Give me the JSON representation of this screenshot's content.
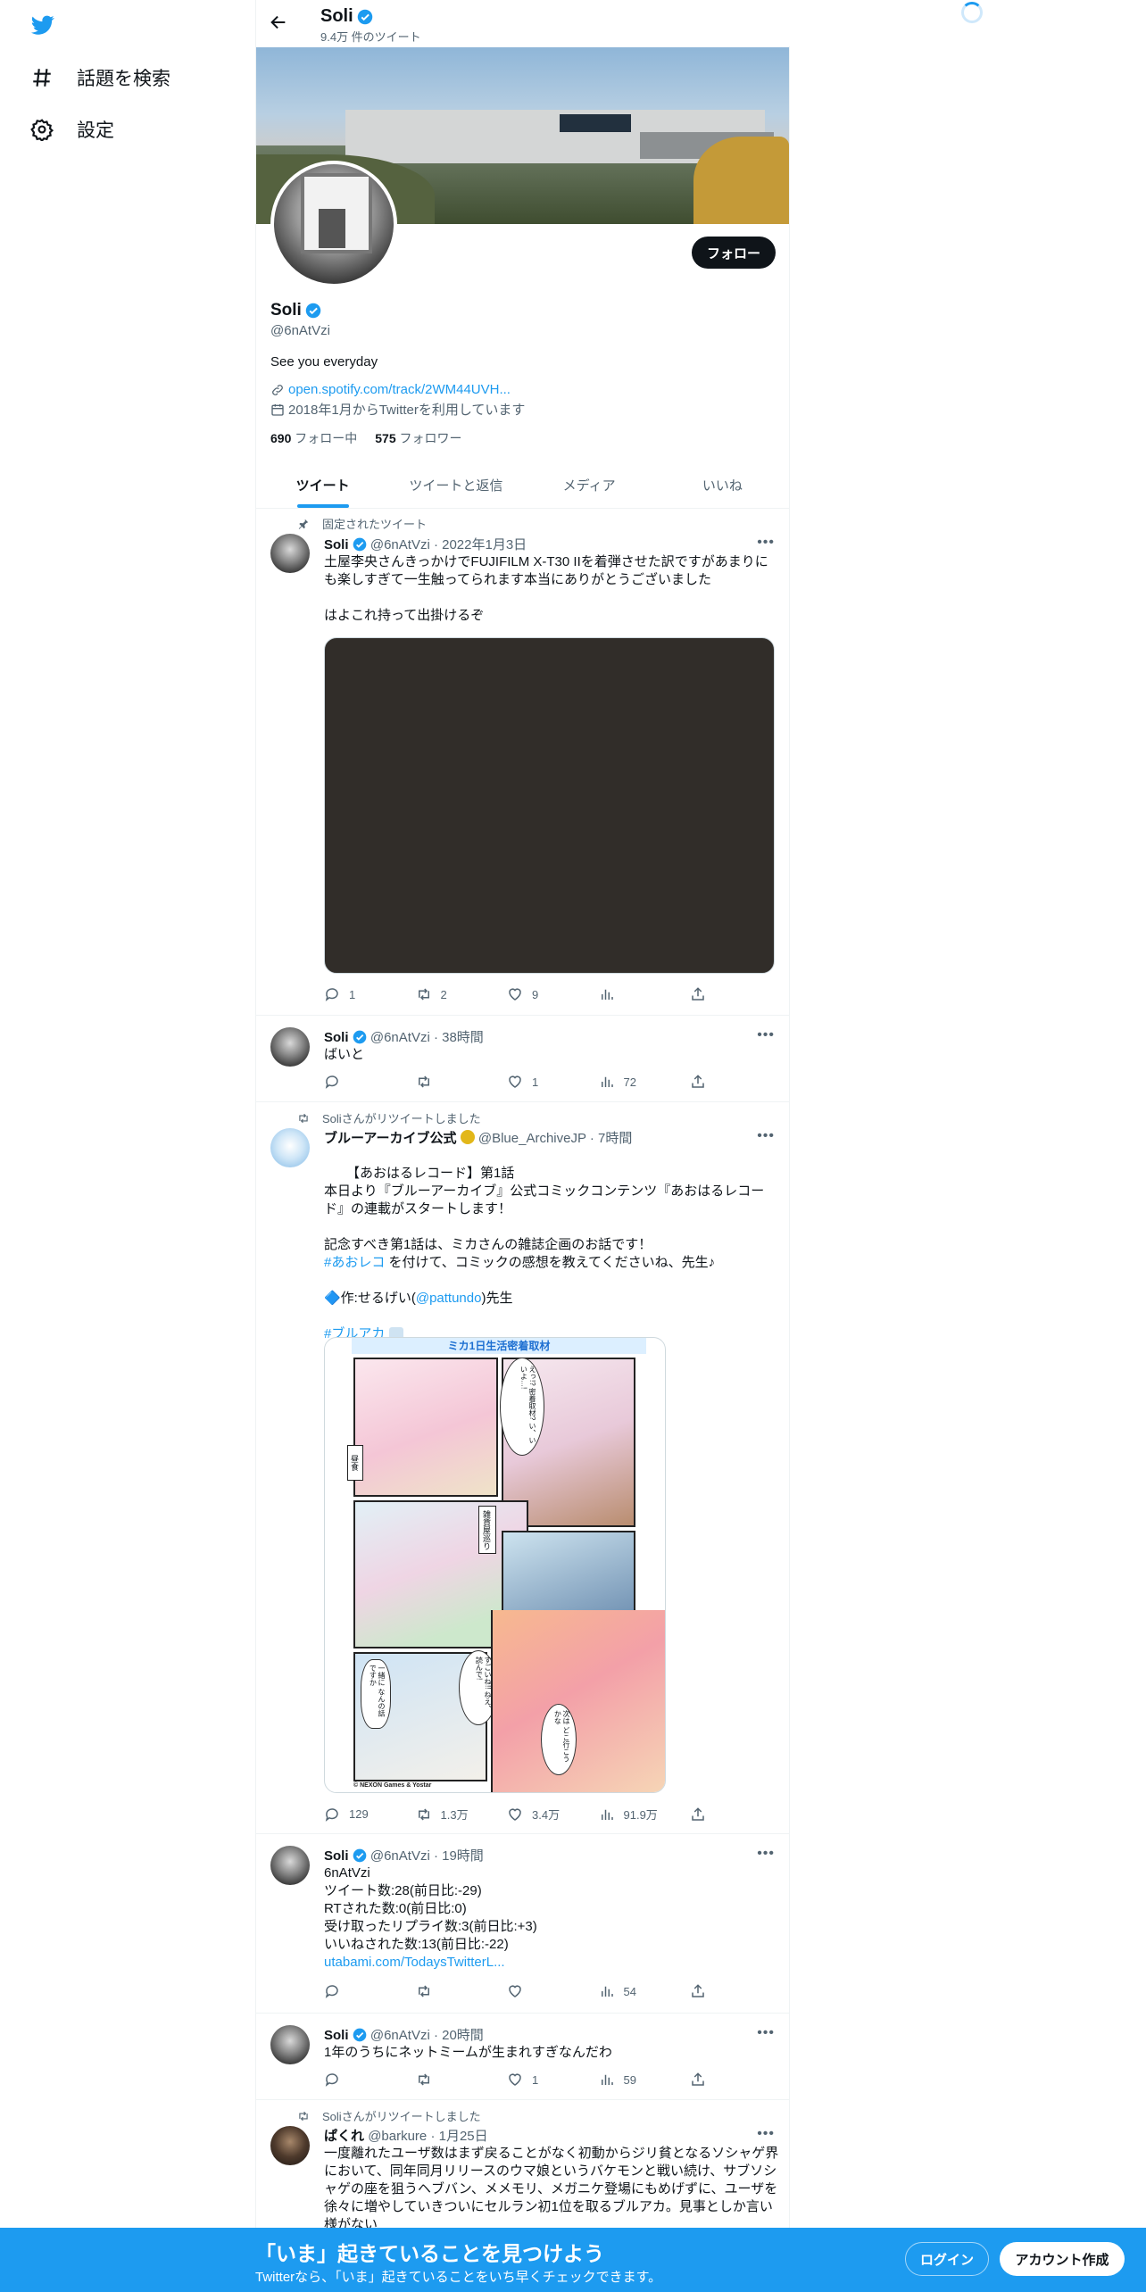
{
  "sidebar": {
    "explore_label": "話題を検索",
    "settings_label": "設定"
  },
  "header": {
    "name": "Soli",
    "tweet_count": "9.4万 件のツイート"
  },
  "profile": {
    "name": "Soli",
    "handle": "@6nAtVzi",
    "bio": "See you everyday",
    "link": "open.spotify.com/track/2WM44UVH...",
    "joined": "2018年1月からTwitterを利用しています",
    "following_count": "690",
    "following_label": "フォロー中",
    "followers_count": "575",
    "followers_label": "フォロワー",
    "follow_button": "フォロー"
  },
  "tabs": [
    "ツイート",
    "ツイートと返信",
    "メディア",
    "いいね"
  ],
  "tweets": [
    {
      "context": "固定されたツイート",
      "name": "Soli",
      "handle": "@6nAtVzi",
      "time": "2022年1月3日",
      "text": "土屋李央さんきっかけでFUJIFILM X-T30 IIを着弾させた訳ですがあまりにも楽しすぎて一生触ってられます本当にありがとうございました\n\nはよこれ持って出掛けるぞ",
      "reply": "1",
      "retweet": "2",
      "like": "9",
      "views": ""
    },
    {
      "name": "Soli",
      "handle": "@6nAtVzi",
      "time": "38時間",
      "text": "ばいと",
      "reply": "",
      "retweet": "",
      "like": "1",
      "views": "72"
    },
    {
      "context": "Soliさんがリツイートしました",
      "name": "ブルーアーカイブ公式",
      "handle": "@Blue_ArchiveJP",
      "time": "7時間",
      "text_1": "【あおはるレコード】第1話\n本日より『ブルーアーカイブ』公式コミックコンテンツ『あおはるレコード』の連載がスタートします！\n\n記念すべき第1話は、ミカさんの雑誌企画のお話です！",
      "hashtag_1": "#あおレコ",
      "text_2": " を付けて、コミックの感想を教えてくださいね、先生♪",
      "credit_prefix": "🔷作:せるげい(",
      "mention": "@pattundo",
      "credit_suffix": ")先生",
      "hashtag_2": "#ブルアカ",
      "reply": "129",
      "retweet": "1.3万",
      "like": "3.4万",
      "views": "91.9万"
    },
    {
      "name": "Soli",
      "handle": "@6nAtVzi",
      "time": "19時間",
      "text": "6nAtVzi\nツイート数:28(前日比:-29)\nRTされた数:0(前日比:0)\n受け取ったリプライ数:3(前日比:+3)\nいいねされた数:13(前日比:-22)",
      "link": "utabami.com/TodaysTwitterL...",
      "reply": "",
      "retweet": "",
      "like": "",
      "views": "54"
    },
    {
      "name": "Soli",
      "handle": "@6nAtVzi",
      "time": "20時間",
      "text": "1年のうちにネットミームが生まれすぎなんだわ",
      "reply": "",
      "retweet": "",
      "like": "1",
      "views": "59"
    },
    {
      "context": "Soliさんがリツイートしました",
      "name": "ぱくれ",
      "handle": "@barkure",
      "time": "1月25日",
      "text": "一度離れたユーザ数はまず戻ることがなく初動からジリ貧となるソシャゲ界において、同年同月リリースのウマ娘というバケモンと戦い続け、サブソシャゲの座を狙うヘブバン、メメモリ、メガニケ登場にもめげずに、ユーザを徐々に増やしていきついにセルラン初1位を取るブルアカ。見事としか言い様がない"
    }
  ],
  "comic": {
    "top_text": "ミカ1日生活密着取材",
    "bubble_1": "えっ!? 密着取材? い、いいよ…!",
    "label_1": "昼食",
    "label_2": "雑貨屋巡り",
    "bubble_2": "一緒に なんの話ですか",
    "bubble_3": "すごいね!! ねえ、読んで!",
    "bubble_4": "次は どこ行こうかな",
    "copyright": "© NEXON Games & Yostar"
  },
  "bottom_bar": {
    "headline": "「いま」起きていることを見つけよう",
    "subtext": "Twitterなら、「いま」起きていることをいち早くチェックできます。",
    "login": "ログイン",
    "signup": "アカウント作成"
  }
}
